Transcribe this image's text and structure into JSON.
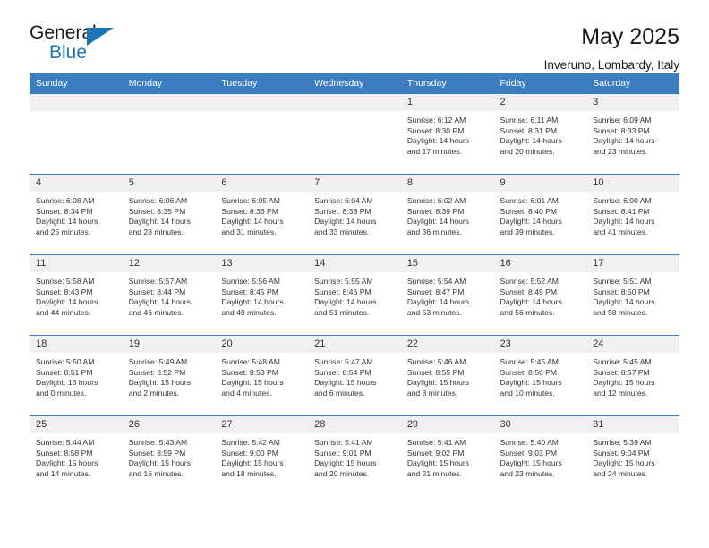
{
  "logo": {
    "word1": "General",
    "word2": "Blue",
    "triangle_color": "#1b75bb"
  },
  "header": {
    "title": "May 2025",
    "subtitle": "Inveruno, Lombardy, Italy"
  },
  "theme": {
    "header_blue": "#3b7dc0",
    "daynum_gray": "#f0f0f0",
    "text": "#333333"
  },
  "weekday_headers": [
    "Sunday",
    "Monday",
    "Tuesday",
    "Wednesday",
    "Thursday",
    "Friday",
    "Saturday"
  ],
  "weeks": [
    [
      {
        "day": "",
        "empty": true
      },
      {
        "day": "",
        "empty": true
      },
      {
        "day": "",
        "empty": true
      },
      {
        "day": "",
        "empty": true
      },
      {
        "day": "1",
        "sunrise": "Sunrise: 6:12 AM",
        "sunset": "Sunset: 8:30 PM",
        "daylight1": "Daylight: 14 hours",
        "daylight2": "and 17 minutes."
      },
      {
        "day": "2",
        "sunrise": "Sunrise: 6:11 AM",
        "sunset": "Sunset: 8:31 PM",
        "daylight1": "Daylight: 14 hours",
        "daylight2": "and 20 minutes."
      },
      {
        "day": "3",
        "sunrise": "Sunrise: 6:09 AM",
        "sunset": "Sunset: 8:33 PM",
        "daylight1": "Daylight: 14 hours",
        "daylight2": "and 23 minutes."
      }
    ],
    [
      {
        "day": "4",
        "sunrise": "Sunrise: 6:08 AM",
        "sunset": "Sunset: 8:34 PM",
        "daylight1": "Daylight: 14 hours",
        "daylight2": "and 25 minutes."
      },
      {
        "day": "5",
        "sunrise": "Sunrise: 6:06 AM",
        "sunset": "Sunset: 8:35 PM",
        "daylight1": "Daylight: 14 hours",
        "daylight2": "and 28 minutes."
      },
      {
        "day": "6",
        "sunrise": "Sunrise: 6:05 AM",
        "sunset": "Sunset: 8:36 PM",
        "daylight1": "Daylight: 14 hours",
        "daylight2": "and 31 minutes."
      },
      {
        "day": "7",
        "sunrise": "Sunrise: 6:04 AM",
        "sunset": "Sunset: 8:38 PM",
        "daylight1": "Daylight: 14 hours",
        "daylight2": "and 33 minutes."
      },
      {
        "day": "8",
        "sunrise": "Sunrise: 6:02 AM",
        "sunset": "Sunset: 8:39 PM",
        "daylight1": "Daylight: 14 hours",
        "daylight2": "and 36 minutes."
      },
      {
        "day": "9",
        "sunrise": "Sunrise: 6:01 AM",
        "sunset": "Sunset: 8:40 PM",
        "daylight1": "Daylight: 14 hours",
        "daylight2": "and 39 minutes."
      },
      {
        "day": "10",
        "sunrise": "Sunrise: 6:00 AM",
        "sunset": "Sunset: 8:41 PM",
        "daylight1": "Daylight: 14 hours",
        "daylight2": "and 41 minutes."
      }
    ],
    [
      {
        "day": "11",
        "sunrise": "Sunrise: 5:58 AM",
        "sunset": "Sunset: 8:43 PM",
        "daylight1": "Daylight: 14 hours",
        "daylight2": "and 44 minutes."
      },
      {
        "day": "12",
        "sunrise": "Sunrise: 5:57 AM",
        "sunset": "Sunset: 8:44 PM",
        "daylight1": "Daylight: 14 hours",
        "daylight2": "and 46 minutes."
      },
      {
        "day": "13",
        "sunrise": "Sunrise: 5:56 AM",
        "sunset": "Sunset: 8:45 PM",
        "daylight1": "Daylight: 14 hours",
        "daylight2": "and 49 minutes."
      },
      {
        "day": "14",
        "sunrise": "Sunrise: 5:55 AM",
        "sunset": "Sunset: 8:46 PM",
        "daylight1": "Daylight: 14 hours",
        "daylight2": "and 51 minutes."
      },
      {
        "day": "15",
        "sunrise": "Sunrise: 5:54 AM",
        "sunset": "Sunset: 8:47 PM",
        "daylight1": "Daylight: 14 hours",
        "daylight2": "and 53 minutes."
      },
      {
        "day": "16",
        "sunrise": "Sunrise: 5:52 AM",
        "sunset": "Sunset: 8:49 PM",
        "daylight1": "Daylight: 14 hours",
        "daylight2": "and 56 minutes."
      },
      {
        "day": "17",
        "sunrise": "Sunrise: 5:51 AM",
        "sunset": "Sunset: 8:50 PM",
        "daylight1": "Daylight: 14 hours",
        "daylight2": "and 58 minutes."
      }
    ],
    [
      {
        "day": "18",
        "sunrise": "Sunrise: 5:50 AM",
        "sunset": "Sunset: 8:51 PM",
        "daylight1": "Daylight: 15 hours",
        "daylight2": "and 0 minutes."
      },
      {
        "day": "19",
        "sunrise": "Sunrise: 5:49 AM",
        "sunset": "Sunset: 8:52 PM",
        "daylight1": "Daylight: 15 hours",
        "daylight2": "and 2 minutes."
      },
      {
        "day": "20",
        "sunrise": "Sunrise: 5:48 AM",
        "sunset": "Sunset: 8:53 PM",
        "daylight1": "Daylight: 15 hours",
        "daylight2": "and 4 minutes."
      },
      {
        "day": "21",
        "sunrise": "Sunrise: 5:47 AM",
        "sunset": "Sunset: 8:54 PM",
        "daylight1": "Daylight: 15 hours",
        "daylight2": "and 6 minutes."
      },
      {
        "day": "22",
        "sunrise": "Sunrise: 5:46 AM",
        "sunset": "Sunset: 8:55 PM",
        "daylight1": "Daylight: 15 hours",
        "daylight2": "and 8 minutes."
      },
      {
        "day": "23",
        "sunrise": "Sunrise: 5:45 AM",
        "sunset": "Sunset: 8:56 PM",
        "daylight1": "Daylight: 15 hours",
        "daylight2": "and 10 minutes."
      },
      {
        "day": "24",
        "sunrise": "Sunrise: 5:45 AM",
        "sunset": "Sunset: 8:57 PM",
        "daylight1": "Daylight: 15 hours",
        "daylight2": "and 12 minutes."
      }
    ],
    [
      {
        "day": "25",
        "sunrise": "Sunrise: 5:44 AM",
        "sunset": "Sunset: 8:58 PM",
        "daylight1": "Daylight: 15 hours",
        "daylight2": "and 14 minutes."
      },
      {
        "day": "26",
        "sunrise": "Sunrise: 5:43 AM",
        "sunset": "Sunset: 8:59 PM",
        "daylight1": "Daylight: 15 hours",
        "daylight2": "and 16 minutes."
      },
      {
        "day": "27",
        "sunrise": "Sunrise: 5:42 AM",
        "sunset": "Sunset: 9:00 PM",
        "daylight1": "Daylight: 15 hours",
        "daylight2": "and 18 minutes."
      },
      {
        "day": "28",
        "sunrise": "Sunrise: 5:41 AM",
        "sunset": "Sunset: 9:01 PM",
        "daylight1": "Daylight: 15 hours",
        "daylight2": "and 20 minutes."
      },
      {
        "day": "29",
        "sunrise": "Sunrise: 5:41 AM",
        "sunset": "Sunset: 9:02 PM",
        "daylight1": "Daylight: 15 hours",
        "daylight2": "and 21 minutes."
      },
      {
        "day": "30",
        "sunrise": "Sunrise: 5:40 AM",
        "sunset": "Sunset: 9:03 PM",
        "daylight1": "Daylight: 15 hours",
        "daylight2": "and 23 minutes."
      },
      {
        "day": "31",
        "sunrise": "Sunrise: 5:39 AM",
        "sunset": "Sunset: 9:04 PM",
        "daylight1": "Daylight: 15 hours",
        "daylight2": "and 24 minutes."
      }
    ]
  ]
}
